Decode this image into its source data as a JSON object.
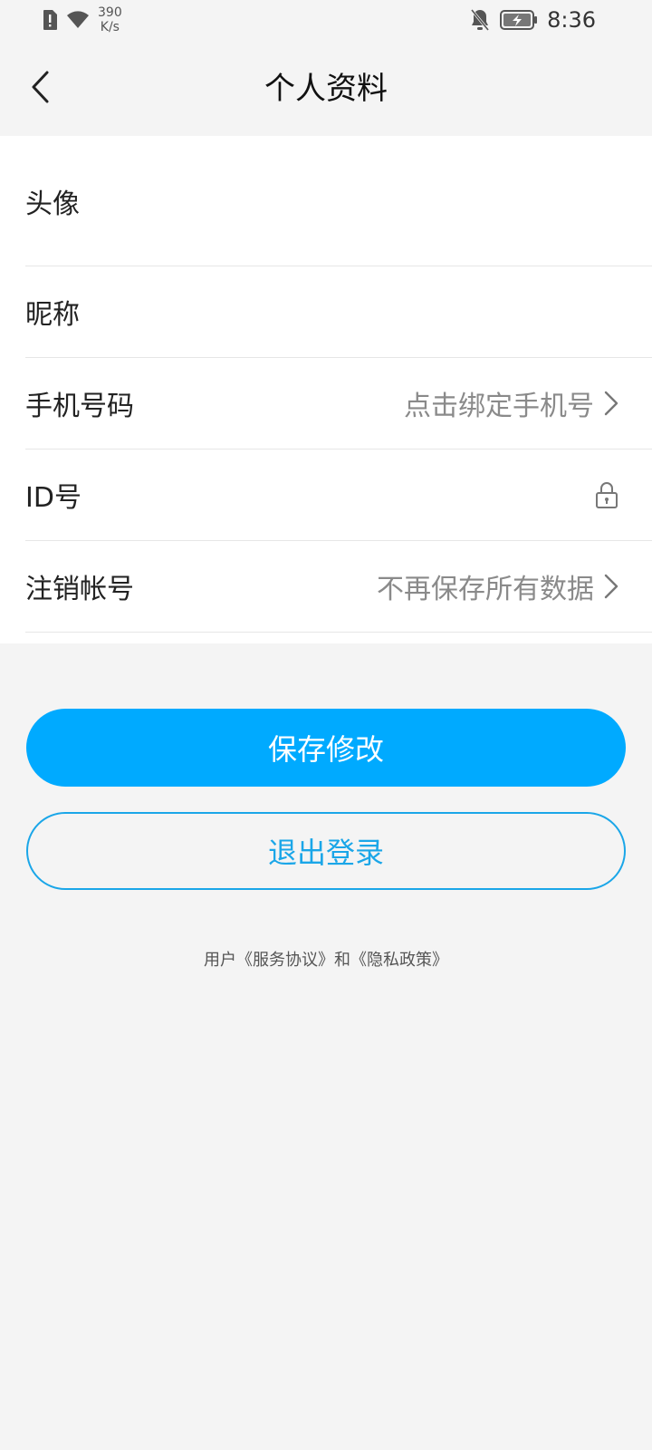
{
  "status_bar": {
    "speed_value": "390",
    "speed_unit": "K/s",
    "time": "8:36",
    "icons": [
      "sim-alert-icon",
      "wifi-icon",
      "bell-off-icon",
      "battery-charging-icon"
    ]
  },
  "header": {
    "title": "个人资料",
    "back_icon": "chevron-left-icon"
  },
  "profile": {
    "rows": [
      {
        "label": "头像"
      },
      {
        "label": "昵称"
      },
      {
        "label": "手机号码",
        "value": "点击绑定手机号"
      },
      {
        "label": "ID号"
      },
      {
        "label": "注销帐号",
        "value": "不再保存所有数据"
      }
    ]
  },
  "actions": {
    "save_label": "保存修改",
    "logout_label": "退出登录"
  },
  "footer": {
    "prefix": "用户",
    "service_link": "《服务协议》",
    "and": "和",
    "privacy_link": "《隐私政策》"
  },
  "colors": {
    "accent": "#00aaff",
    "outline": "#1aa6e8",
    "background": "#f4f4f4"
  }
}
